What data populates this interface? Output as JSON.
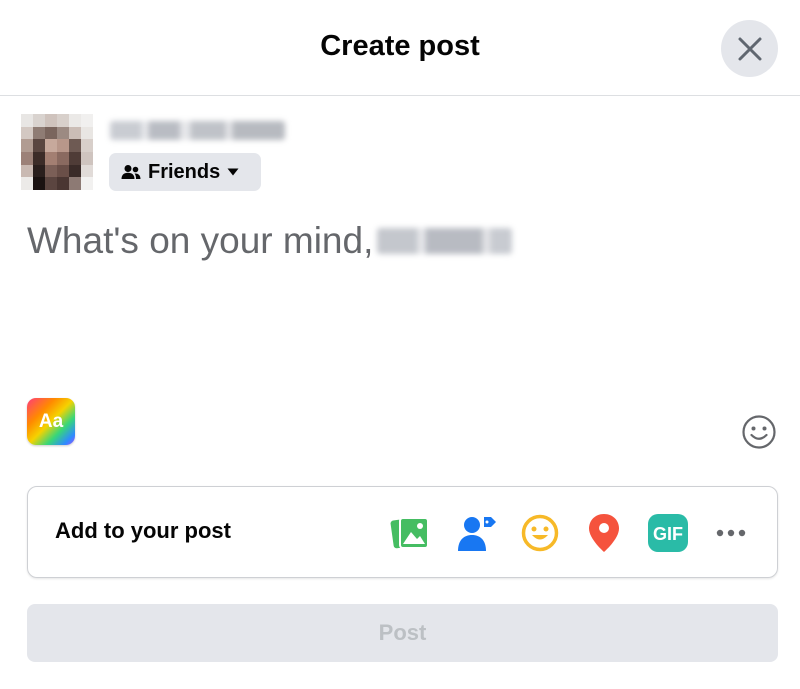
{
  "dialog": {
    "title": "Create post"
  },
  "audience": {
    "label": "Friends"
  },
  "composer": {
    "placeholder": "What's on your mind,"
  },
  "text_style": {
    "label": "Aa"
  },
  "add_to_post": {
    "label": "Add to your post",
    "icons": [
      "photo-video-icon",
      "tag-people-icon",
      "feeling-activity-icon",
      "check-in-icon",
      "gif-icon",
      "more-icon"
    ],
    "gif_label": "GIF"
  },
  "post_button": {
    "label": "Post",
    "enabled": false
  },
  "colors": {
    "photo": "#45bd62",
    "tag": "#1877f2",
    "feeling": "#f7b928",
    "check_in": "#f5533d",
    "gif": "#2abba7",
    "secondary_text": "#65676b",
    "button_bg": "#e4e6eb"
  }
}
